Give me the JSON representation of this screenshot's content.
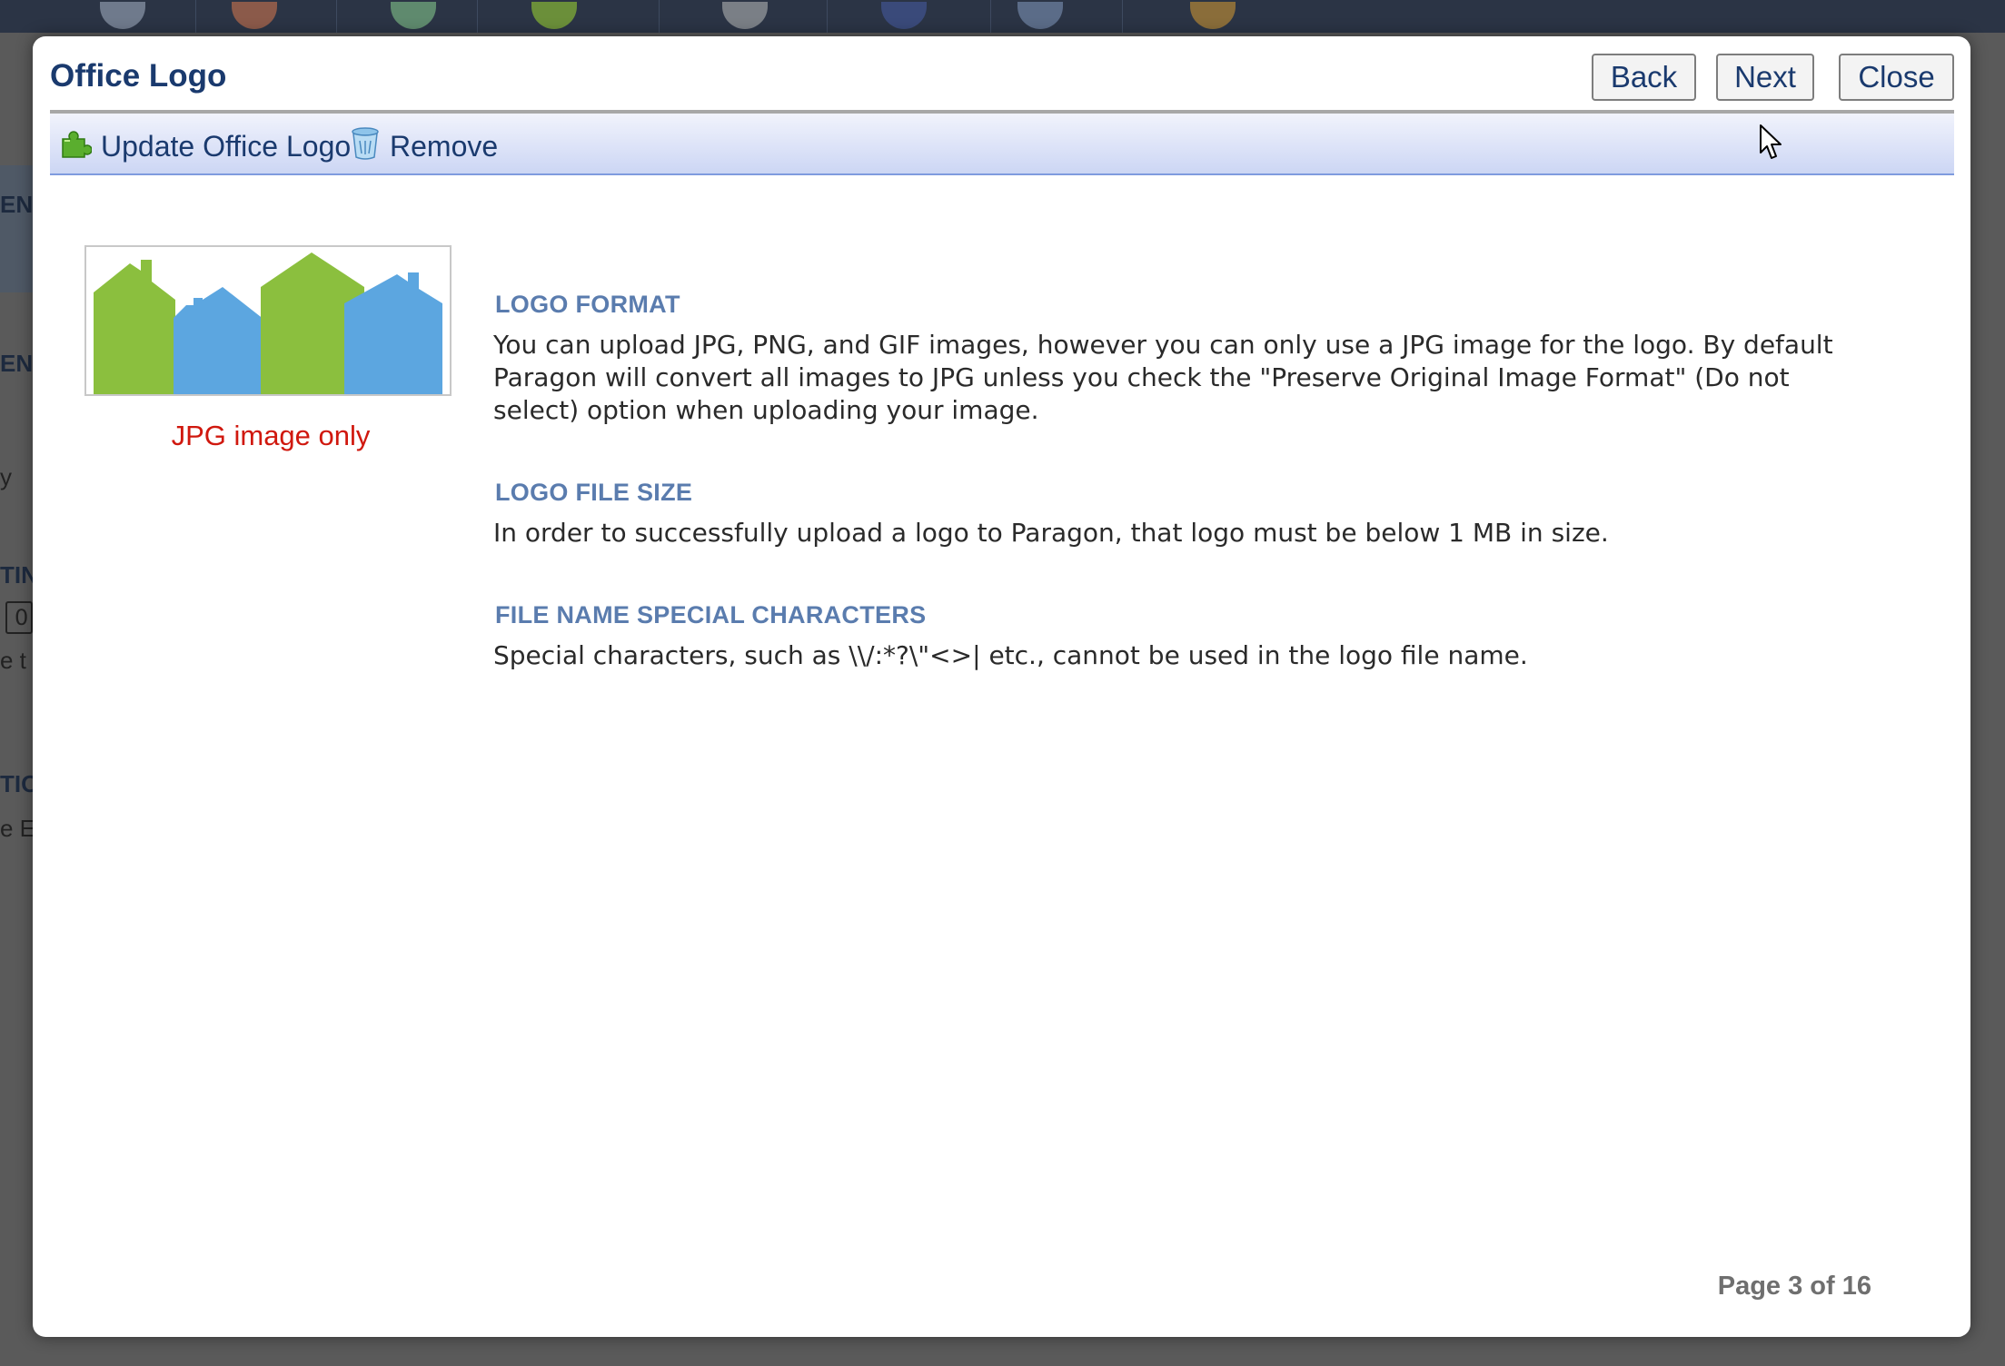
{
  "background": {
    "fragments": [
      "EN",
      "y",
      "TIN",
      "0",
      "e t",
      "TIO",
      "e E"
    ]
  },
  "modal": {
    "title": "Office Logo",
    "buttons": {
      "back": "Back",
      "next": "Next",
      "close": "Close"
    },
    "toolbar": {
      "update_label": "Update Office Logo",
      "remove_label": "Remove",
      "update_icon": "green-puzzle-add-icon",
      "remove_icon": "trash-bin-icon"
    },
    "logo_preview": {
      "caption": "JPG image only",
      "colors": {
        "green": "#8bbf3e",
        "blue": "#5ca6e0"
      }
    },
    "sections": [
      {
        "heading": "LOGO FORMAT",
        "body": "You can upload JPG, PNG, and GIF images, however you can only use a JPG image for the logo. By default Paragon will convert all images to JPG unless you check the \"Preserve Original Image Format\" (Do not select) option when uploading your image."
      },
      {
        "heading": "LOGO FILE SIZE",
        "body": "In order to successfully upload a logo to Paragon, that logo must be below 1 MB in size."
      },
      {
        "heading": "FILE NAME SPECIAL CHARACTERS",
        "body": "Special characters, such as \\\\/:*?\\\"<>| etc., cannot be used in the logo file name."
      }
    ],
    "page_indicator": "Page 3 of 16"
  },
  "colors": {
    "title": "#1a3a6e",
    "section_heading": "#5a7cae",
    "caption_red": "#d0180e",
    "toolbar_border": "#7f9bde"
  }
}
